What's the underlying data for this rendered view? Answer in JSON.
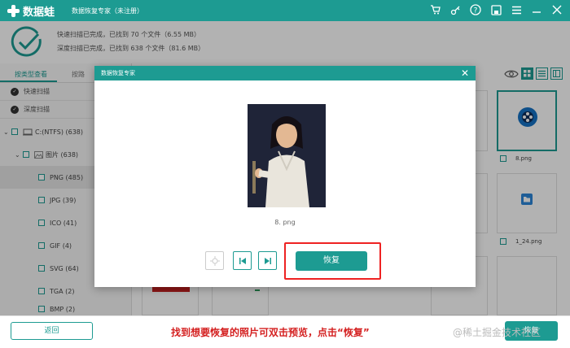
{
  "app": {
    "name": "数据蛙",
    "window_title": "数据恢复专家（未注册）"
  },
  "status": {
    "line1": "快速扫描已完成，已找到 70 个文件（6.55 MB）",
    "line2": "深度扫描已完成，已找到 638 个文件（81.6 MB）"
  },
  "sidebar": {
    "tabs": [
      {
        "label": "按类型查看"
      },
      {
        "label": "按路"
      }
    ],
    "scan_modes": [
      {
        "label": "快速扫描"
      },
      {
        "label": "深度扫描"
      }
    ],
    "drive": "C:(NTFS) (638)",
    "folder": "图片 (638)",
    "types": [
      {
        "label": "PNG (485)"
      },
      {
        "label": "JPG (39)"
      },
      {
        "label": "ICO (41)"
      },
      {
        "label": "GIF (4)"
      },
      {
        "label": "SVG (64)"
      },
      {
        "label": "TGA (2)"
      },
      {
        "label": "BMP (2)"
      }
    ]
  },
  "thumbs": [
    {
      "label": "8.png"
    },
    {
      "label": "1_24.png"
    }
  ],
  "modal": {
    "title": "数据恢复专家",
    "filename": "8. png",
    "recover_label": "恢复"
  },
  "footer": {
    "back_label": "返回",
    "recover_label": "恢复",
    "caption": "找到想要恢复的照片可双击预览，点击“恢复”",
    "watermark": "@稀土掘金技术社区"
  },
  "colors": {
    "accent": "#1d9b92",
    "highlight": "#e22222"
  }
}
